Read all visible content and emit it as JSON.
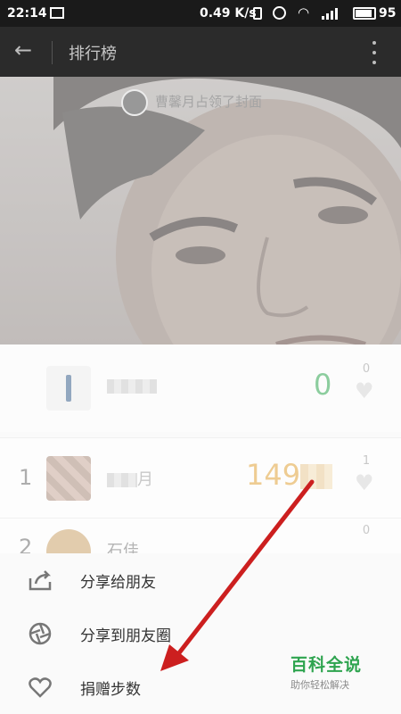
{
  "status_bar": {
    "time": "22:14",
    "network_speed": "0.49 K/s",
    "battery": "95"
  },
  "app_bar": {
    "title": "排行榜",
    "back_icon": "back-arrow-icon",
    "menu_icon": "more-vert-icon"
  },
  "cover": {
    "owner_text": "曹馨月占领了封面"
  },
  "ranking": {
    "me": {
      "steps": "0",
      "likes": "0"
    },
    "items": [
      {
        "rank": "1",
        "name": "月",
        "steps": "149",
        "likes": "1"
      },
      {
        "rank": "2",
        "name": "石佳",
        "likes": "0"
      }
    ]
  },
  "share_sheet": {
    "items": [
      {
        "label": "分享给朋友",
        "icon": "share-icon"
      },
      {
        "label": "分享到朋友圈",
        "icon": "moments-shutter-icon"
      },
      {
        "label": "捐赠步数",
        "icon": "heart-hands-icon"
      }
    ]
  },
  "watermark": {
    "brand": "百科全说",
    "tagline": "助你轻松解决"
  },
  "colors": {
    "accent_green": "#2ea44f",
    "steps_orange": "#e0a23a",
    "annotation_red": "#cc1f1f"
  }
}
